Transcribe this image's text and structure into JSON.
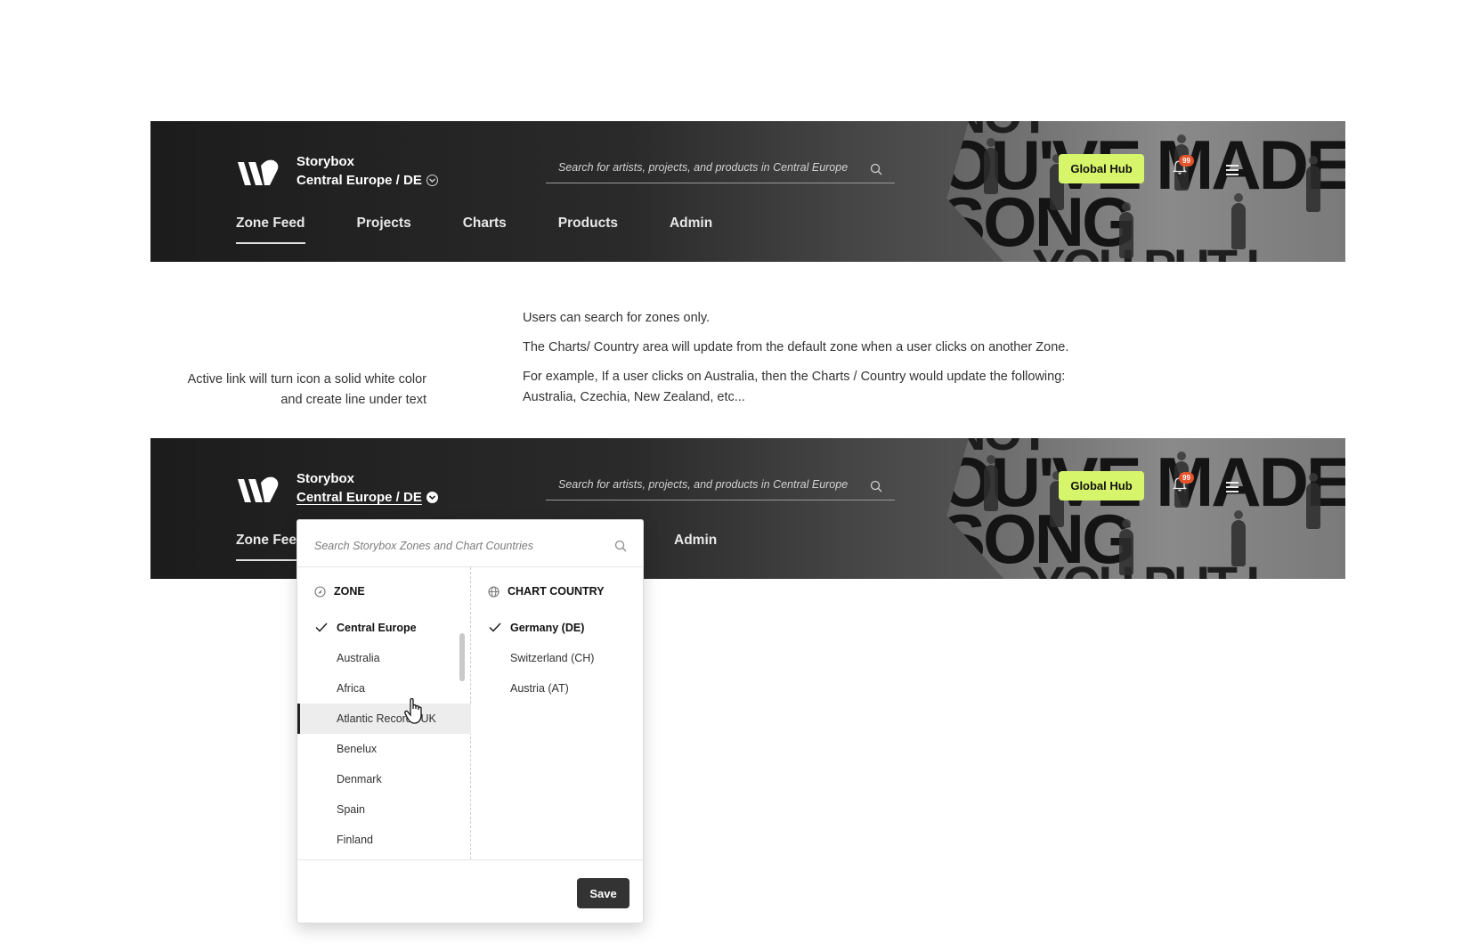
{
  "header": {
    "brand_name": "Storybox",
    "zone_label": "Central Europe / DE",
    "search_placeholder": "Search for artists, projects, and products in Central Europe",
    "global_hub": "Global Hub",
    "notification_count": "99",
    "nav": [
      {
        "label": "Zone Feed",
        "active": true
      },
      {
        "label": "Projects",
        "active": false
      },
      {
        "label": "Charts",
        "active": false
      },
      {
        "label": "Products",
        "active": false
      },
      {
        "label": "Admin",
        "active": false
      }
    ],
    "hero_text": [
      "NOT",
      "OU'VE MADE",
      "SONG",
      "YOU PUT I"
    ],
    "header2_nav_visible": {
      "first": "Zone Fee",
      "last": "Admin"
    }
  },
  "notes": {
    "left": [
      "Active link will turn icon a solid white color",
      "and create line under text"
    ],
    "right": [
      "Users can search for zones only.",
      "The Charts/ Country area will update from the default zone when a user clicks on another Zone.",
      "For example, If a user clicks on Australia, then the Charts / Country would update the following: Australia, Czechia, New Zealand, etc..."
    ]
  },
  "dropdown": {
    "search_placeholder": "Search Storybox Zones and Chart Countries",
    "zone_heading": "ZONE",
    "chart_heading": "CHART COUNTRY",
    "zones": [
      {
        "label": "Central Europe",
        "selected": true
      },
      {
        "label": "Australia",
        "selected": false
      },
      {
        "label": "Africa",
        "selected": false
      },
      {
        "label": "Atlantic Records UK",
        "selected": false,
        "hover": true
      },
      {
        "label": "Benelux",
        "selected": false
      },
      {
        "label": "Denmark",
        "selected": false
      },
      {
        "label": "Spain",
        "selected": false
      },
      {
        "label": "Finland",
        "selected": false
      }
    ],
    "countries": [
      {
        "label": "Germany (DE)",
        "selected": true
      },
      {
        "label": "Switzerland (CH)",
        "selected": false
      },
      {
        "label": "Austria (AT)",
        "selected": false
      }
    ],
    "save_label": "Save"
  },
  "colors": {
    "accent": "#d7f56a",
    "badge": "#e4532c",
    "header_dark": "#1c1c1c",
    "save_button": "#333333"
  },
  "icons": [
    "search-icon",
    "zone-target-icon",
    "globe-icon",
    "check-icon",
    "bell-icon",
    "hamburger-menu-icon",
    "chevron-down-circle-icon",
    "hand-pointer-cursor-icon"
  ]
}
